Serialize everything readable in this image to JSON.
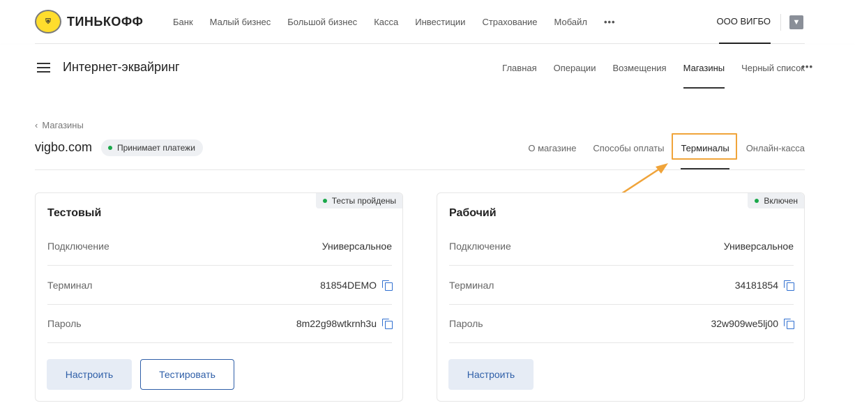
{
  "brand": {
    "logo_text": "ТИНЬКОФФ"
  },
  "top_nav": {
    "items": [
      "Банк",
      "Малый бизнес",
      "Большой бизнес",
      "Касса",
      "Инвестиции",
      "Страхование",
      "Мобайл"
    ],
    "more": "•••",
    "company": "ООО ВИГБО"
  },
  "sub_header": {
    "title": "Интернет-эквайринг",
    "nav": [
      "Главная",
      "Операции",
      "Возмещения",
      "Магазины",
      "Черный список"
    ],
    "active": "Магазины",
    "more": "•••"
  },
  "breadcrumb": {
    "label": "Магазины"
  },
  "shop": {
    "name": "vigbo.com",
    "status": "Принимает платежи",
    "tabs": [
      "О магазине",
      "Способы оплаты",
      "Терминалы",
      "Онлайн-касса"
    ],
    "active_tab": "Терминалы"
  },
  "colors": {
    "accent_blue": "#2f5fa8",
    "status_green": "#1aa84a",
    "highlight_orange": "#f0a43a"
  },
  "terminals": {
    "test": {
      "title": "Тестовый",
      "badge": "Тесты пройдены",
      "rows": [
        {
          "label": "Подключение",
          "value": "Универсальное"
        },
        {
          "label": "Терминал",
          "value": "81854DEMO"
        },
        {
          "label": "Пароль",
          "value": "8m22g98wtkrnh3u"
        }
      ],
      "configure": "Настроить",
      "test_button": "Тестировать"
    },
    "prod": {
      "title": "Рабочий",
      "badge": "Включен",
      "rows": [
        {
          "label": "Подключение",
          "value": "Универсальное"
        },
        {
          "label": "Терминал",
          "value": "34181854"
        },
        {
          "label": "Пароль",
          "value": "32w909we5lj00"
        }
      ],
      "configure": "Настроить"
    }
  }
}
